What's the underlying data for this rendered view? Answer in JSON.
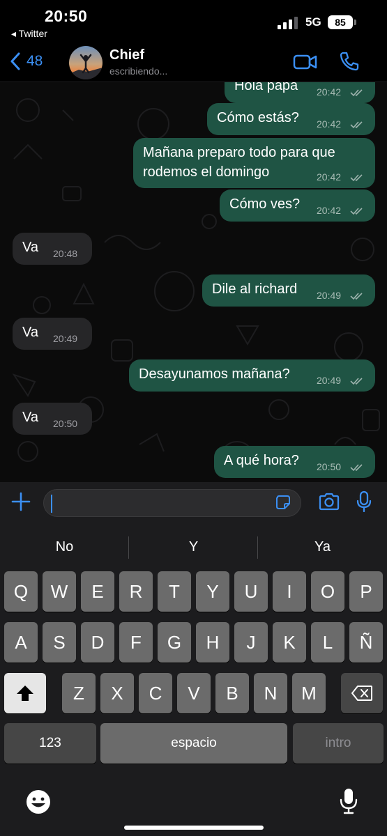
{
  "status_bar": {
    "time": "20:50",
    "back_app": "◂ Twitter",
    "network": "5G",
    "battery": "85"
  },
  "header": {
    "back_count": "48",
    "name": "Chief",
    "status": "escribiendo..."
  },
  "messages": [
    {
      "direction": "out",
      "text": "Hola papa",
      "time": "20:42"
    },
    {
      "direction": "out",
      "text": "Cómo estás?",
      "time": "20:42"
    },
    {
      "direction": "out",
      "text_line1": "Mañana preparo todo para que",
      "text_line2": "rodemos el domingo",
      "time": "20:42"
    },
    {
      "direction": "out",
      "text": "Cómo ves?",
      "time": "20:42"
    },
    {
      "direction": "in",
      "text": "Va",
      "time": "20:48"
    },
    {
      "direction": "out",
      "text": "Dile al richard",
      "time": "20:49"
    },
    {
      "direction": "in",
      "text": "Va",
      "time": "20:49"
    },
    {
      "direction": "out",
      "text": "Desayunamos mañana?",
      "time": "20:49"
    },
    {
      "direction": "in",
      "text": "Va",
      "time": "20:50"
    },
    {
      "direction": "out",
      "text": "A qué hora?",
      "time": "20:50"
    }
  ],
  "input": {
    "value": ""
  },
  "keyboard": {
    "suggestions": [
      "No",
      "Y",
      "Ya"
    ],
    "row1": [
      "Q",
      "W",
      "E",
      "R",
      "T",
      "Y",
      "U",
      "I",
      "O",
      "P"
    ],
    "row2": [
      "A",
      "S",
      "D",
      "F",
      "G",
      "H",
      "J",
      "K",
      "L",
      "Ñ"
    ],
    "row3": [
      "Z",
      "X",
      "C",
      "V",
      "B",
      "N",
      "M"
    ],
    "numbers_label": "123",
    "space_label": "espacio",
    "return_label": "intro"
  },
  "colors": {
    "accent": "#3b8ff3",
    "outgoing_bubble": "#1f5444",
    "incoming_bubble": "#262628",
    "tick": "#9db3ad"
  },
  "icons": [
    "back-chevron-icon",
    "video-icon",
    "phone-icon",
    "plus-icon",
    "sticker-icon",
    "camera-icon",
    "mic-icon",
    "emoji-icon",
    "dictation-icon",
    "shift-icon",
    "backspace-icon"
  ]
}
